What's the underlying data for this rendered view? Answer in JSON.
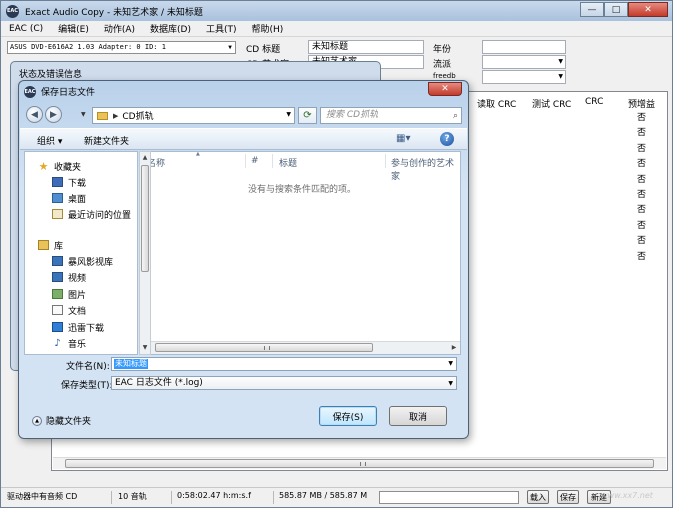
{
  "main": {
    "title": "Exact Audio Copy  -  未知艺术家 / 未知标题",
    "window_controls": {
      "minimize": "—",
      "maximize": "□",
      "close": "✕"
    },
    "menu": [
      "EAC (C)",
      "编辑(E)",
      "动作(A)",
      "数据库(D)",
      "工具(T)",
      "帮助(H)"
    ],
    "drive": "ASUS    DVD-E616A2 1.03   Adapter: 0  ID: 1",
    "cd_title_label": "CD 标题",
    "cd_title_value": "未知标题",
    "cd_artist_label": "CD 艺术家",
    "cd_artist_value": "未知艺术家",
    "year_label": "年份",
    "genre_label": "流派",
    "freedb_label": "freedb",
    "columns": [
      "读取 CRC",
      "测试 CRC",
      "CRC",
      "预增益"
    ],
    "no_values": [
      "否",
      "否",
      "否",
      "否",
      "否",
      "否",
      "否",
      "否",
      "否",
      "否"
    ]
  },
  "status_bar": {
    "status": "驱动器中有音频 CD",
    "tracks": "10 音轨",
    "duration": "0:58:02.47 h:m:s.f",
    "size": "585.87 MB / 585.87 M",
    "load_button": "载入",
    "save_button": "保存",
    "new_button": "新建"
  },
  "bg_dialog": {
    "title": "状态及错误信息"
  },
  "save_dialog": {
    "title": "保存日志文件",
    "close": "✕",
    "breadcrumb": "CD抓轨",
    "search_placeholder": "搜索 CD抓轨",
    "organize": "组织 ▾",
    "new_folder": "新建文件夹",
    "help": "?",
    "nav_items": [
      {
        "label": "收藏夹",
        "icon": "star-icon"
      },
      {
        "label": "下载",
        "icon": "download-folder-icon"
      },
      {
        "label": "桌面",
        "icon": "desktop-icon"
      },
      {
        "label": "最近访问的位置",
        "icon": "recent-places-icon"
      },
      {
        "label": "库",
        "icon": "library-icon"
      },
      {
        "label": "暴风影视库",
        "icon": "video-library-icon"
      },
      {
        "label": "视频",
        "icon": "video-icon"
      },
      {
        "label": "图片",
        "icon": "pictures-icon"
      },
      {
        "label": "文档",
        "icon": "documents-icon"
      },
      {
        "label": "迅雷下载",
        "icon": "thunder-download-icon"
      },
      {
        "label": "音乐",
        "icon": "music-icon"
      }
    ],
    "file_columns": [
      "名称",
      "#",
      "标题",
      "参与创作的艺术家"
    ],
    "empty_message": "没有与搜索条件匹配的项。",
    "filename_label": "文件名(N):",
    "filename_value": "未知标题",
    "filetype_label": "保存类型(T):",
    "filetype_value": "EAC 日志文件 (*.log)",
    "hide_folders": "隐藏文件夹",
    "save_button": "保存(S)",
    "cancel_button": "取消"
  },
  "watermark": "www.xx7.net"
}
